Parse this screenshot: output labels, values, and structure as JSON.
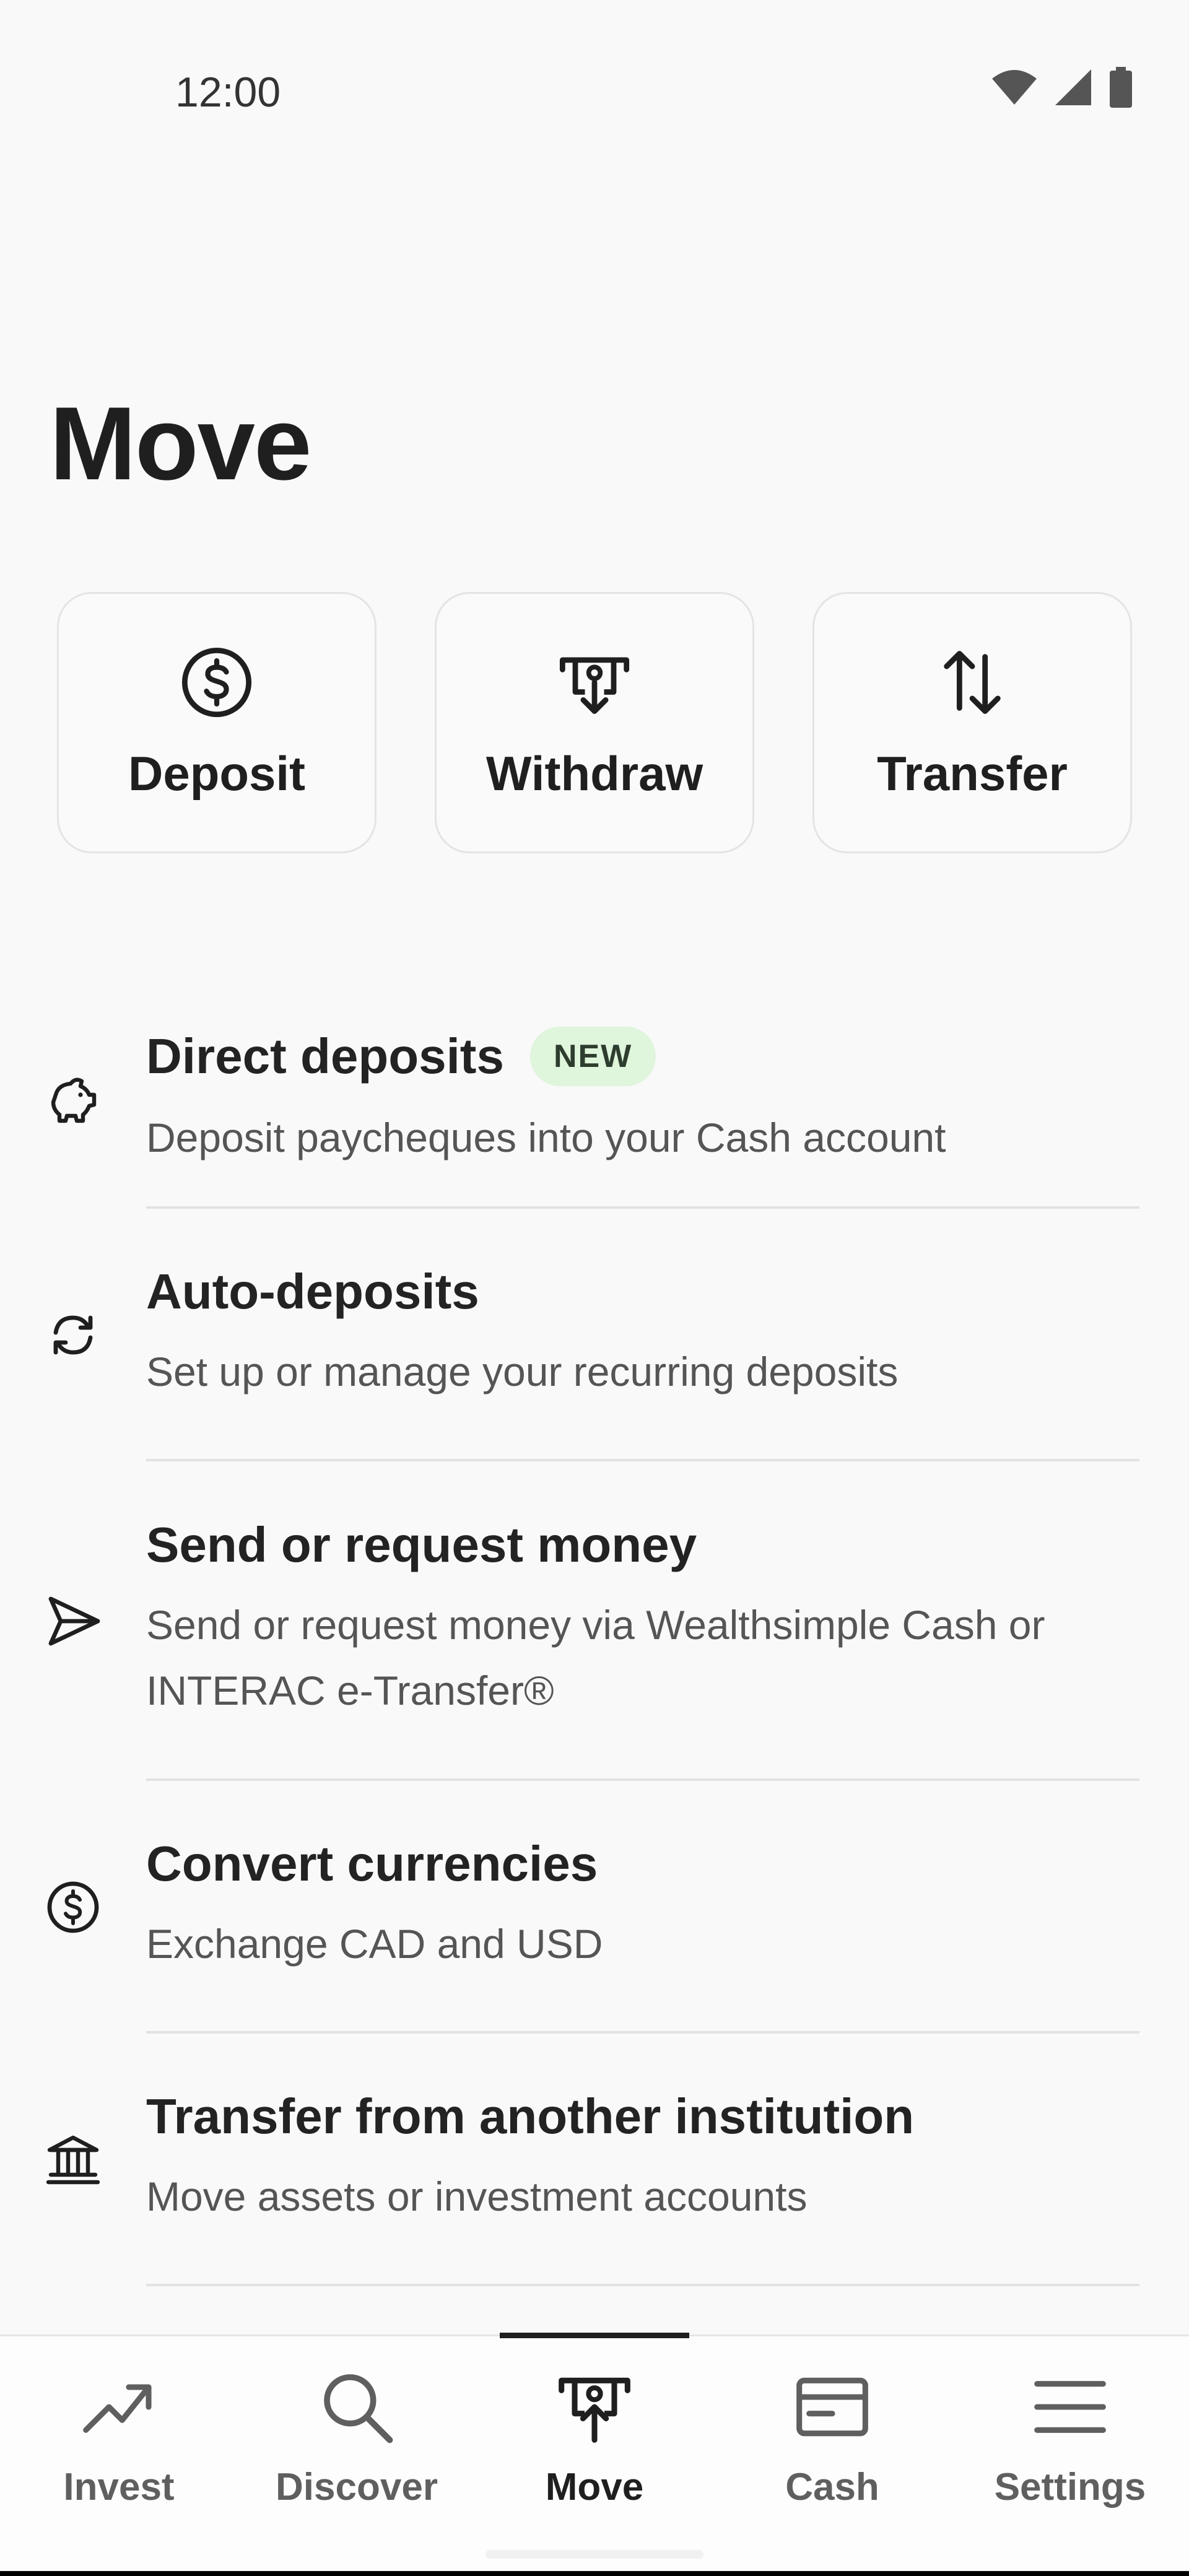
{
  "status_bar": {
    "time": "12:00",
    "icons": [
      "wifi-icon",
      "signal-icon",
      "battery-icon"
    ]
  },
  "page": {
    "title": "Move"
  },
  "actions": [
    {
      "label": "Deposit",
      "icon": "dollar-circle-icon"
    },
    {
      "label": "Withdraw",
      "icon": "withdraw-icon"
    },
    {
      "label": "Transfer",
      "icon": "transfer-arrows-icon"
    }
  ],
  "menu": [
    {
      "title": "Direct deposits",
      "badge": "NEW",
      "subtitle": "Deposit paycheques into your Cash account",
      "icon": "piggy-bank-icon"
    },
    {
      "title": "Auto-deposits",
      "subtitle": "Set up or manage your recurring deposits",
      "icon": "recurring-icon"
    },
    {
      "title": "Send or request money",
      "subtitle": "Send or request money via Wealthsimple Cash or INTERAC e-Transfer®",
      "icon": "send-icon"
    },
    {
      "title": "Convert currencies",
      "subtitle": "Exchange CAD and USD",
      "icon": "dollar-circle-icon"
    },
    {
      "title": "Transfer from another institution",
      "subtitle": "Move assets or investment accounts",
      "icon": "bank-icon"
    }
  ],
  "tabs": [
    {
      "label": "Invest",
      "icon": "trending-up-icon",
      "active": false
    },
    {
      "label": "Discover",
      "icon": "search-icon",
      "active": false
    },
    {
      "label": "Move",
      "icon": "withdraw-icon",
      "active": true
    },
    {
      "label": "Cash",
      "icon": "card-icon",
      "active": false
    },
    {
      "label": "Settings",
      "icon": "menu-icon",
      "active": false
    }
  ],
  "colors": {
    "background": "#f9f9f9",
    "text": "#1f1f1f",
    "badge_bg": "#dff5dc"
  }
}
